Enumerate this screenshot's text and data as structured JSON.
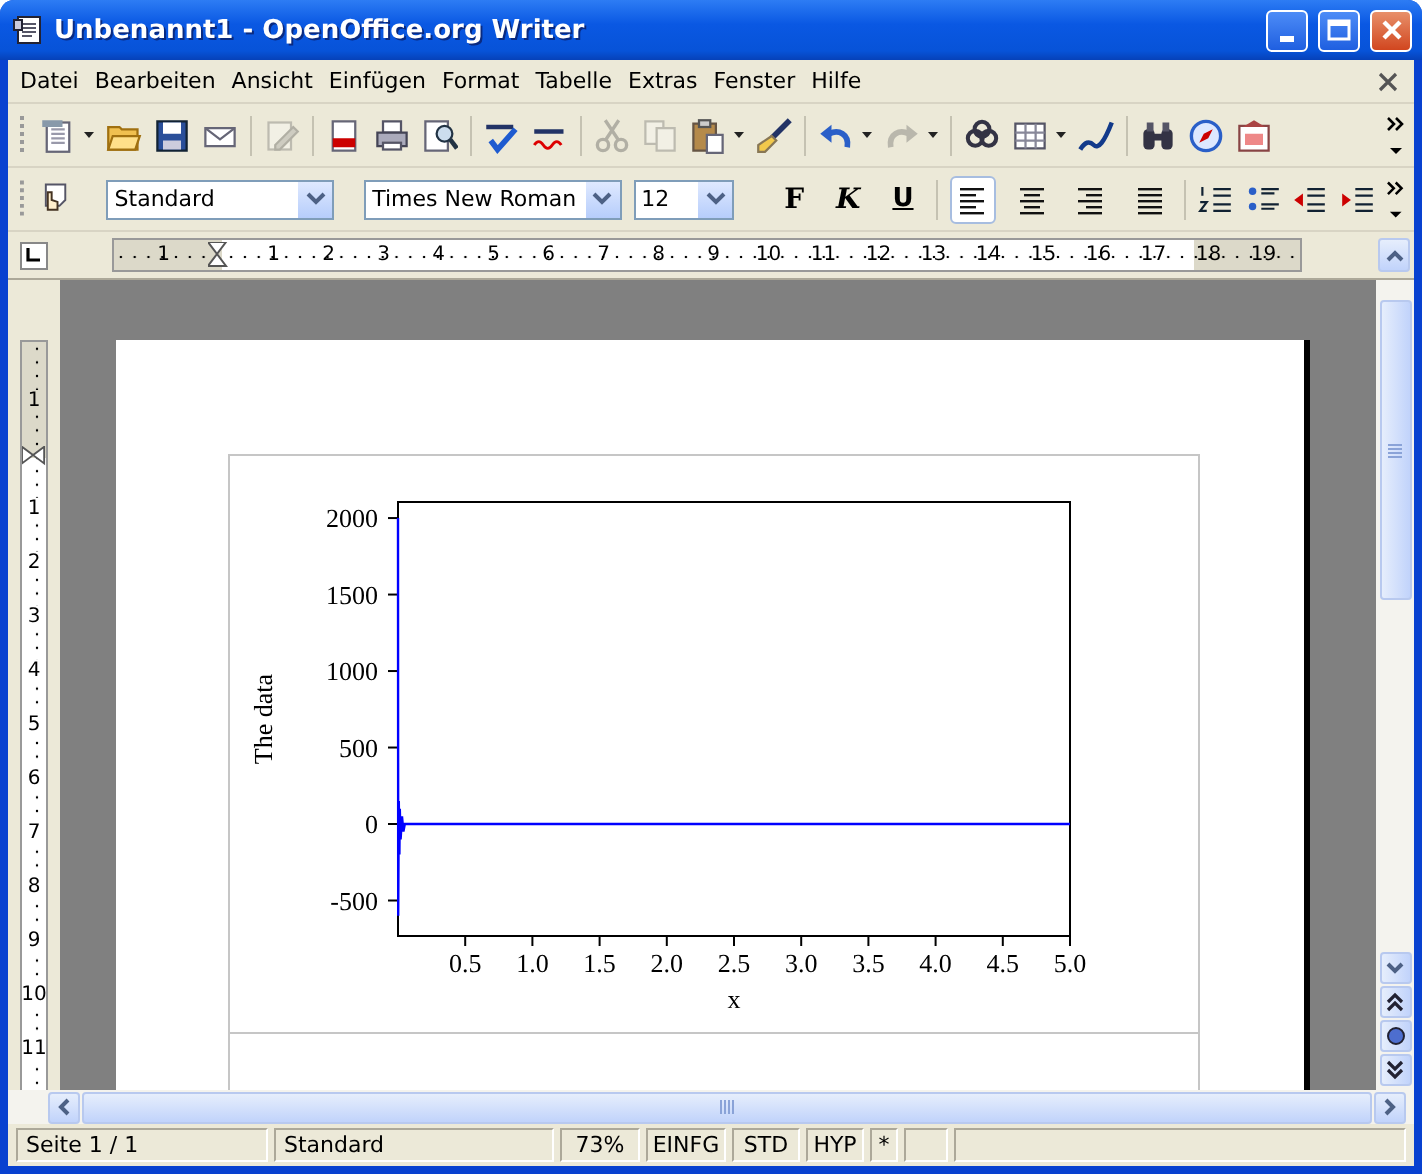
{
  "window": {
    "title": "Unbenannt1 - OpenOffice.org Writer"
  },
  "menu": [
    "Datei",
    "Bearbeiten",
    "Ansicht",
    "Einfügen",
    "Format",
    "Tabelle",
    "Extras",
    "Fenster",
    "Hilfe"
  ],
  "toolbar_standard": [
    [
      {
        "kind": "new",
        "dropdown": true,
        "disabled": false
      },
      {
        "kind": "open",
        "dropdown": false,
        "disabled": false
      },
      {
        "kind": "save",
        "dropdown": false,
        "disabled": false
      },
      {
        "kind": "email",
        "dropdown": false,
        "disabled": false
      }
    ],
    [
      {
        "kind": "edit",
        "dropdown": false,
        "disabled": true
      }
    ],
    [
      {
        "kind": "pdf",
        "dropdown": false,
        "disabled": false
      },
      {
        "kind": "print",
        "dropdown": false,
        "disabled": false
      },
      {
        "kind": "preview",
        "dropdown": false,
        "disabled": false
      }
    ],
    [
      {
        "kind": "spell",
        "dropdown": false,
        "disabled": false
      },
      {
        "kind": "autospell",
        "dropdown": false,
        "disabled": false
      }
    ],
    [
      {
        "kind": "cut",
        "dropdown": false,
        "disabled": true
      },
      {
        "kind": "copy",
        "dropdown": false,
        "disabled": true
      },
      {
        "kind": "paste",
        "dropdown": true,
        "disabled": false
      },
      {
        "kind": "brush",
        "dropdown": false,
        "disabled": false
      }
    ],
    [
      {
        "kind": "undo",
        "dropdown": true,
        "disabled": false
      },
      {
        "kind": "redo",
        "dropdown": true,
        "disabled": true
      }
    ],
    [
      {
        "kind": "link",
        "dropdown": false,
        "disabled": false
      },
      {
        "kind": "table",
        "dropdown": true,
        "disabled": false
      },
      {
        "kind": "draw",
        "dropdown": false,
        "disabled": false
      }
    ],
    [
      {
        "kind": "find",
        "dropdown": false,
        "disabled": false
      },
      {
        "kind": "nav",
        "dropdown": false,
        "disabled": false
      },
      {
        "kind": "gallery",
        "dropdown": false,
        "disabled": false
      }
    ]
  ],
  "toolbar_formatting": {
    "style": "Standard",
    "font": "Times New Roman",
    "size": "12",
    "text_buttons": [
      {
        "kind": "bold",
        "label": "F"
      },
      {
        "kind": "italic",
        "label": "K"
      },
      {
        "kind": "underline",
        "label": "U"
      }
    ],
    "alignment": [
      {
        "kind": "left",
        "selected": true
      },
      {
        "kind": "center",
        "selected": false
      },
      {
        "kind": "right",
        "selected": false
      },
      {
        "kind": "justify",
        "selected": false
      }
    ],
    "lists": [
      {
        "kind": "numbering"
      },
      {
        "kind": "bullets"
      },
      {
        "kind": "outdent"
      },
      {
        "kind": "indent"
      }
    ]
  },
  "ruler": {
    "horizontal": [
      "1",
      "1",
      "2",
      "3",
      "4",
      "5",
      "6",
      "7",
      "8",
      "9",
      "10",
      "11",
      "12",
      "13",
      "14",
      "15",
      "16",
      "17",
      "18",
      "19"
    ],
    "vertical": [
      "1",
      "1",
      "2",
      "3",
      "4",
      "5",
      "6",
      "7",
      "8",
      "9",
      "10",
      "11"
    ]
  },
  "document": {
    "chart_data": {
      "type": "line",
      "xlabel": "x",
      "ylabel": "The data",
      "xlim": [
        0,
        5
      ],
      "ylim": [
        -732,
        2105
      ],
      "xticks": [
        {
          "value": 0.5,
          "label": "0.5"
        },
        {
          "value": 1,
          "label": "1.0"
        },
        {
          "value": 1.5,
          "label": "1.5"
        },
        {
          "value": 2,
          "label": "2.0"
        },
        {
          "value": 2.5,
          "label": "2.5"
        },
        {
          "value": 3,
          "label": "3.0"
        },
        {
          "value": 3.5,
          "label": "3.5"
        },
        {
          "value": 4,
          "label": "4.0"
        },
        {
          "value": 4.5,
          "label": "4.5"
        },
        {
          "value": 5,
          "label": "5.0"
        }
      ],
      "yticks": [
        -500,
        0,
        500,
        1000,
        1500,
        2000
      ],
      "x": [
        0,
        0.002,
        0.006,
        0.01,
        0.014,
        0.02,
        0.03,
        0.04,
        0.05,
        0.1,
        0.5,
        1,
        2,
        3,
        4,
        5
      ],
      "series": [
        {
          "color": "#0000ff",
          "values": [
            2000,
            -600,
            150,
            -200,
            100,
            -100,
            50,
            -50,
            0,
            0,
            0,
            0,
            0,
            0,
            0,
            0
          ]
        }
      ]
    }
  },
  "status_bar": [
    "Seite 1 / 1",
    "Standard",
    "73%",
    "EINFG",
    "STD",
    "HYP",
    "*"
  ]
}
